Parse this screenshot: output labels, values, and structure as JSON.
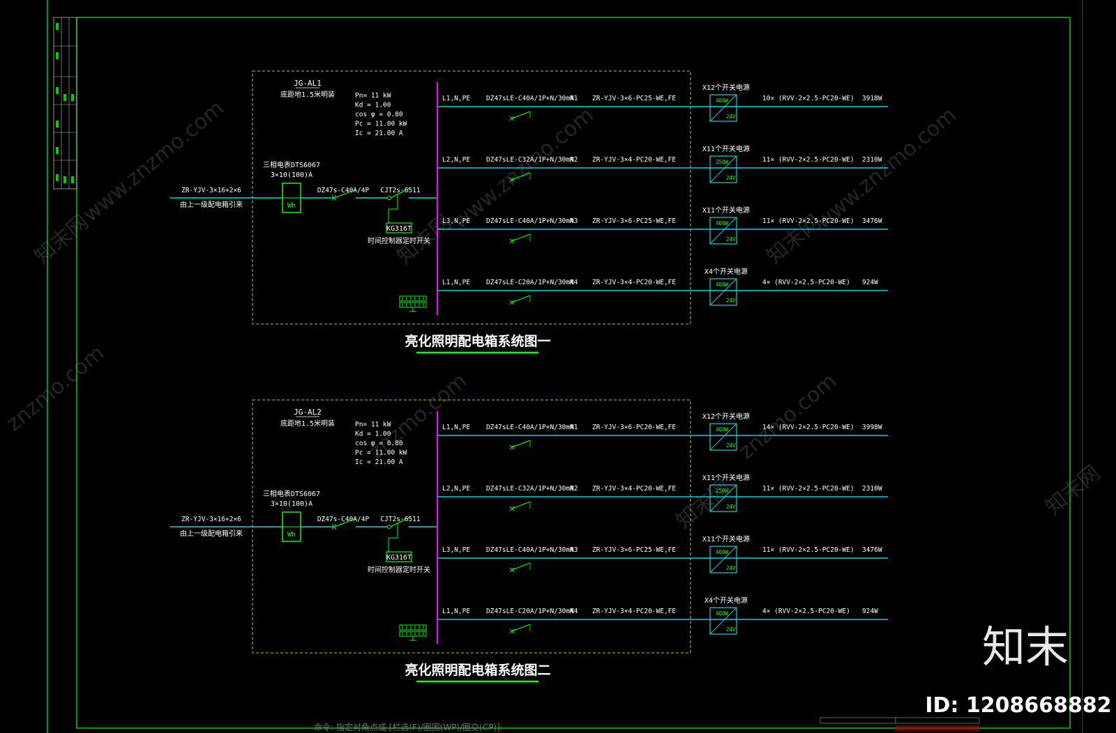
{
  "colors": {
    "background": "#000000",
    "frame": "#00cc00",
    "bus": "#ff00ff",
    "wire": "#00d7d7",
    "device": "#00ff00",
    "text": "#ffffff",
    "box_border": "#c8c800",
    "title_underline": "#00ff00"
  },
  "diagrams": [
    {
      "box_id": "JG-AL1",
      "mount_note": "底距地1.5米明装",
      "params": [
        "Pn= 11 kW",
        "Kd = 1.00",
        "cos φ = 0.80",
        "Pc = 11.00 kW",
        "Ic = 21.00 A"
      ],
      "incoming_cable": "ZR-YJV-3×16+2×6",
      "incoming_note": "由上一级配电箱引来",
      "meter_label": "三相电表DTS6067",
      "meter_rating": "3×10(100)A",
      "meter_symbol": "Wh",
      "main_breaker": "DZ47s-C40A/4P",
      "contactor": "CJT2s-6511",
      "timer": "KG316T",
      "timer_note": "时间控制器定时开关",
      "title": "亮化照明配电箱系统图一",
      "circuits": [
        {
          "phase": "L1,N,PE",
          "breaker": "DZ47sLE-C40A/1P+N/30mA",
          "id": "N1",
          "cable": "ZR-YJV-3×6-PC25-WE,FE",
          "psu": "X12个开关电源",
          "psu_w": "400W",
          "psu_v": "24V",
          "load": "10× (RVV-2×2.5-PC20-WE)",
          "power": "3918W"
        },
        {
          "phase": "L2,N,PE",
          "breaker": "DZ47sLE-C32A/1P+N/30mA",
          "id": "N2",
          "cable": "ZR-YJV-3×4-PC20-WE,FE",
          "psu": "X11个开关电源",
          "psu_w": "250W",
          "psu_v": "24V",
          "load": "11× (RVV-2×2.5-PC20-WE)",
          "power": "2310W"
        },
        {
          "phase": "L3,N,PE",
          "breaker": "DZ47sLE-C40A/1P+N/30mA",
          "id": "N3",
          "cable": "ZR-YJV-3×6-PC25-WE,FE",
          "psu": "X11个开关电源",
          "psu_w": "400W",
          "psu_v": "24V",
          "load": "11× (RVV-2×2.5-PC20-WE)",
          "power": "3476W"
        },
        {
          "phase": "L1,N,PE",
          "breaker": "DZ47sLE-C20A/1P+N/30mA",
          "id": "N4",
          "cable": "ZR-YJV-3×4-PC20-WE,FE",
          "psu": "X4个开关电源",
          "psu_w": "400W",
          "psu_v": "24V",
          "load": "4× (RVV-2×2.5-PC20-WE)",
          "power": "924W"
        }
      ]
    },
    {
      "box_id": "JG-AL2",
      "mount_note": "底距地1.5米明装",
      "params": [
        "Pn= 11 kW",
        "Kd = 1.00",
        "cos φ = 0.80",
        "Pc = 11.00 kW",
        "Ic = 21.00 A"
      ],
      "incoming_cable": "ZR-YJV-3×16+2×6",
      "incoming_note": "由上一级配电箱引来",
      "meter_label": "三相电表DTS6067",
      "meter_rating": "3×10(100)A",
      "meter_symbol": "Wh",
      "main_breaker": "DZ47s-C40A/4P",
      "contactor": "CJT2s-6511",
      "timer": "KG316T",
      "timer_note": "时间控制器定时开关",
      "title": "亮化照明配电箱系统图二",
      "circuits": [
        {
          "phase": "L1,N,PE",
          "breaker": "DZ47sLE-C40A/1P+N/30mA",
          "id": "N1",
          "cable": "ZR-YJV-3×6-PC20-WE,FE",
          "psu": "X12个开关电源",
          "psu_w": "400W",
          "psu_v": "24V",
          "load": "14× (RVV-2×2.5-PC20-WE)",
          "power": "3998W"
        },
        {
          "phase": "L2,N,PE",
          "breaker": "DZ47sLE-C32A/1P+N/30mA",
          "id": "N2",
          "cable": "ZR-YJV-3×4-PC20-WE,FE",
          "psu": "X11个开关电源",
          "psu_w": "250W",
          "psu_v": "24V",
          "load": "11× (RVV-2×2.5-PC20-WE)",
          "power": "2310W"
        },
        {
          "phase": "L3,N,PE",
          "breaker": "DZ47sLE-C40A/1P+N/30mA",
          "id": "N3",
          "cable": "ZR-YJV-3×6-PC25-WE,FE",
          "psu": "X11个开关电源",
          "psu_w": "400W",
          "psu_v": "24V",
          "load": "11× (RVV-2×2.5-PC20-WE)",
          "power": "3476W"
        },
        {
          "phase": "L1,N,PE",
          "breaker": "DZ47sLE-C20A/1P+N/30mA",
          "id": "N4",
          "cable": "ZR-YJV-3×4-PC20-WE,FE",
          "psu": "X4个开关电源",
          "psu_w": "400W",
          "psu_v": "24V",
          "load": "4× (RVV-2×2.5-PC20-WE)",
          "power": "924W"
        }
      ]
    }
  ],
  "command_line": "命令: 指定对角点或 [栏选(F)/圈围(WP)/圈交(CP)]:",
  "watermark": {
    "brand": "知末",
    "id_text": "ID: 1208668882",
    "site": "znzmo.com",
    "site_full": "www.znzmo.com",
    "cn": "知末网"
  }
}
